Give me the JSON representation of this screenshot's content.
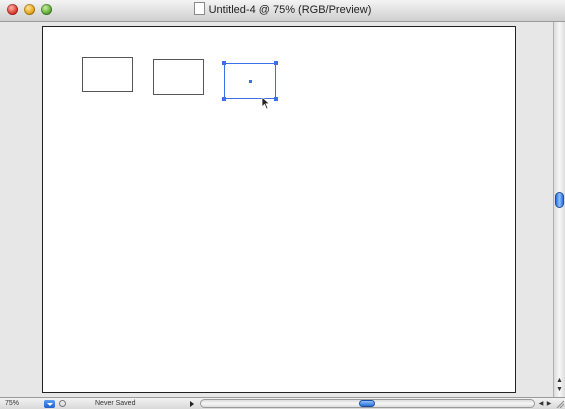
{
  "window": {
    "title": "Untitled-4 @ 75% (RGB/Preview)"
  },
  "titlebar": {
    "close_icon": "close-icon",
    "minimize_icon": "minimize-icon",
    "zoom_icon": "zoom-icon",
    "document_icon": "document-icon"
  },
  "canvas": {
    "artboard_color": "#ffffff",
    "selection_color": "#3d6fe8",
    "shapes": [
      {
        "kind": "rectangle",
        "selected": false
      },
      {
        "kind": "rectangle",
        "selected": false
      },
      {
        "kind": "rectangle",
        "selected": true
      }
    ],
    "cursor": "arrow-cursor-icon"
  },
  "statusbar": {
    "zoom_label": "75%",
    "status_text": "Never Saved"
  }
}
